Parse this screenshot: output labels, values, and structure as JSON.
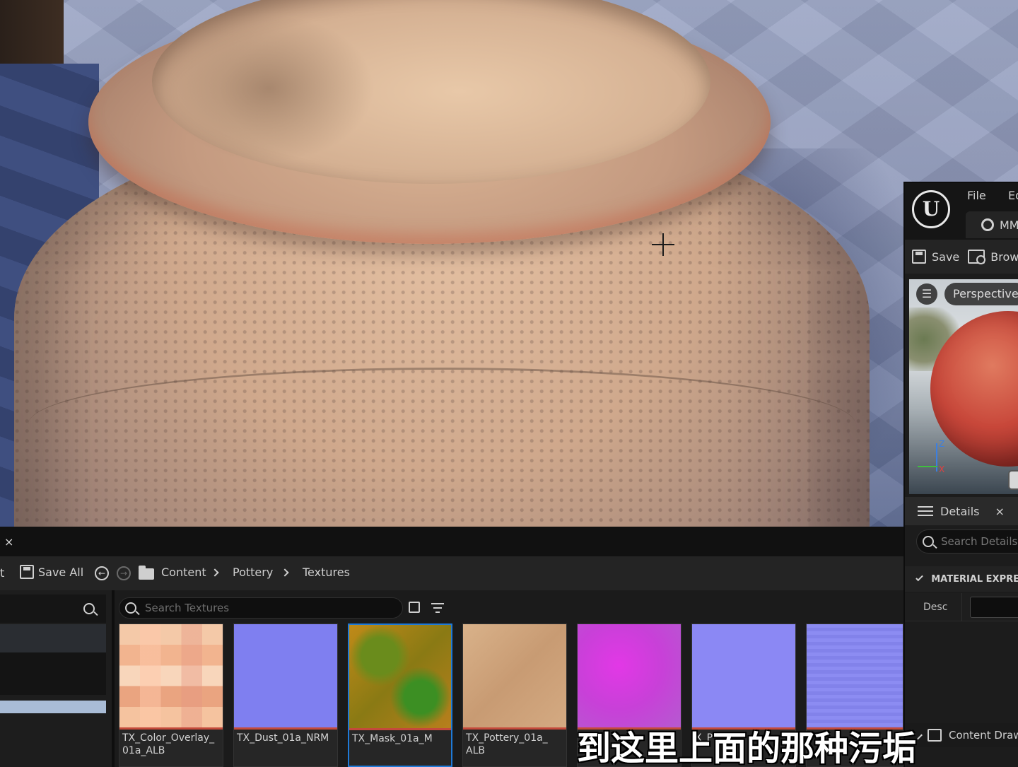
{
  "viewport": {
    "crosshair_icon": "crosshair-icon"
  },
  "material_editor": {
    "logo_text": "U",
    "menu": [
      "File",
      "Ed"
    ],
    "asset_tab": "MM_",
    "toolbar": {
      "save_label": "Save",
      "browse_label": "Brow"
    },
    "preview": {
      "menu_icon": "☰",
      "view_mode": "Perspective",
      "axis_z": "Z",
      "axis_x": "X"
    },
    "details": {
      "title": "Details",
      "close": "×",
      "search_placeholder": "Search Details",
      "section": "MATERIAL EXPRE",
      "desc_label": "Desc"
    },
    "content_drawer_label": "Content Draw"
  },
  "content_browser": {
    "tab_close": "×",
    "toolbar_cut_text": "t",
    "save_all_label": "Save All",
    "breadcrumb": [
      "Content",
      "Pottery",
      "Textures"
    ],
    "search_placeholder": "Search Textures",
    "assets": [
      {
        "label": "TX_Color_Overlay_\n01a_ALB",
        "selected": false
      },
      {
        "label": "TX_Dust_01a_NRM",
        "selected": false
      },
      {
        "label": "TX_Mask_01a_M",
        "selected": true
      },
      {
        "label": "TX_Pottery_01a_\nALB",
        "selected": false
      },
      {
        "label": "",
        "selected": false
      },
      {
        "label": "X_P",
        "selected": false
      },
      {
        "label": "",
        "selected": false
      }
    ]
  },
  "subtitle": "到这里上面的那种污垢",
  "colors": {
    "selection_accent": "#1f7ad8",
    "asset_underline": "#c44a3b",
    "panel_bg": "#1b1b1b"
  }
}
